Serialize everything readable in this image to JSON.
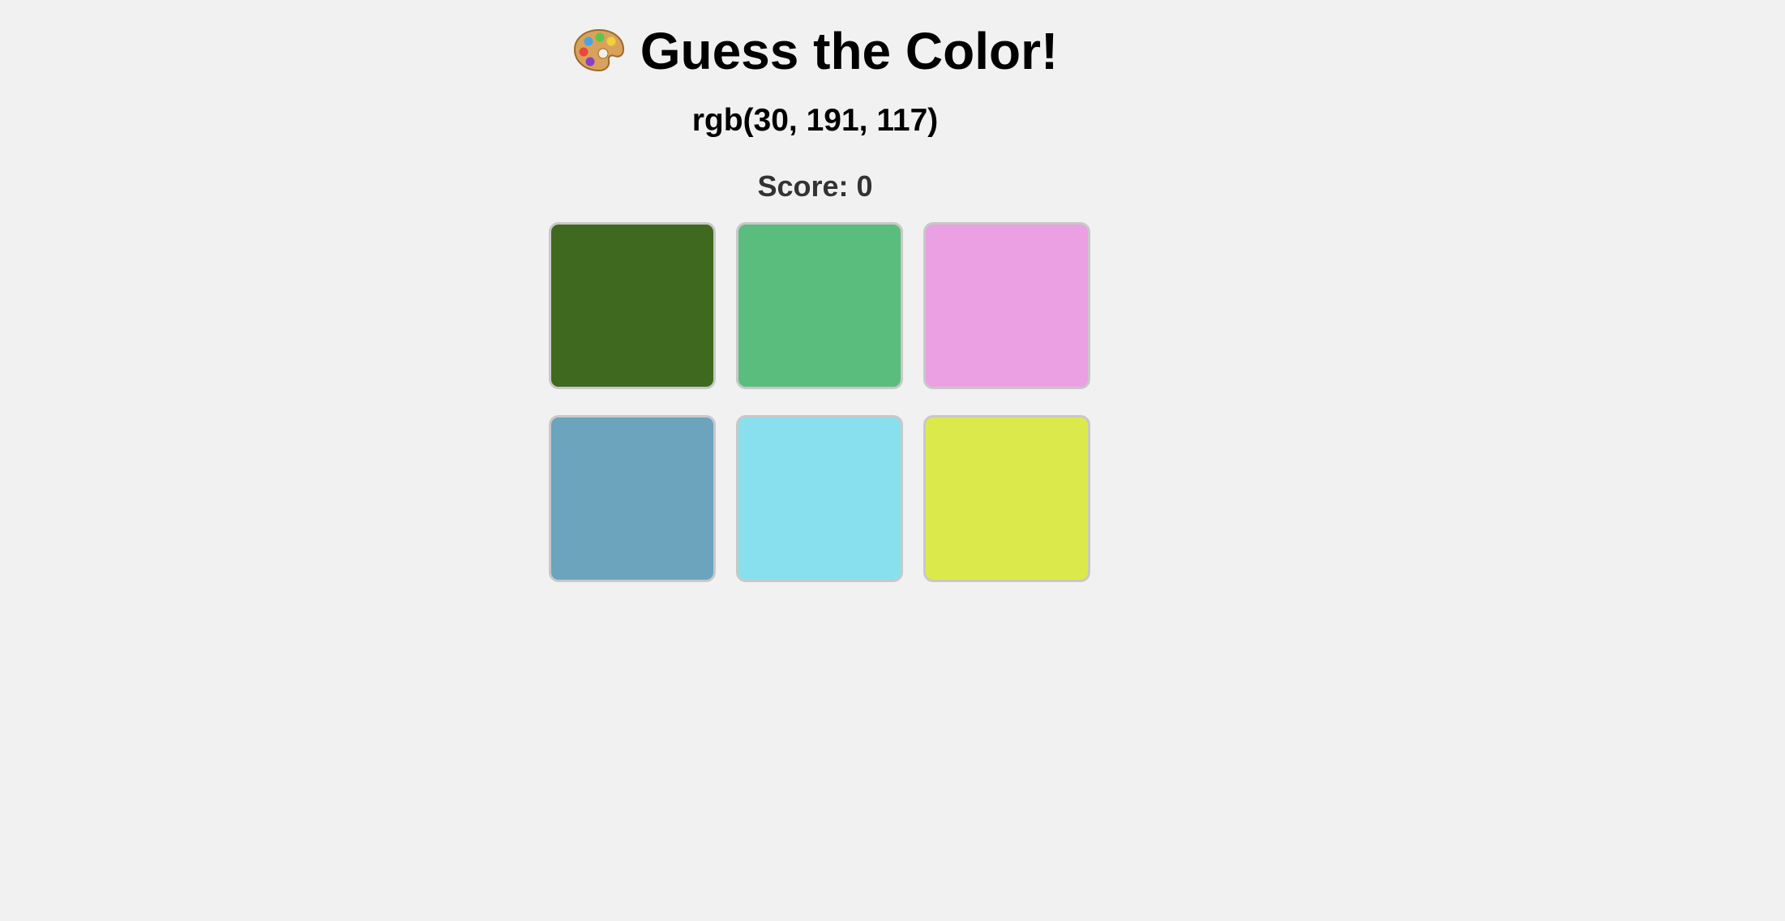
{
  "header": {
    "icon": "palette-icon",
    "title": "Guess the Color!"
  },
  "target": {
    "rgb_text": "rgb(30, 191, 117)"
  },
  "score": {
    "label": "Score: 0"
  },
  "swatches": [
    {
      "color": "#3f691f"
    },
    {
      "color": "#5abd7d"
    },
    {
      "color": "#eaa0e2"
    },
    {
      "color": "#6ca3bd"
    },
    {
      "color": "#88e0ef"
    },
    {
      "color": "#dce94b"
    }
  ]
}
